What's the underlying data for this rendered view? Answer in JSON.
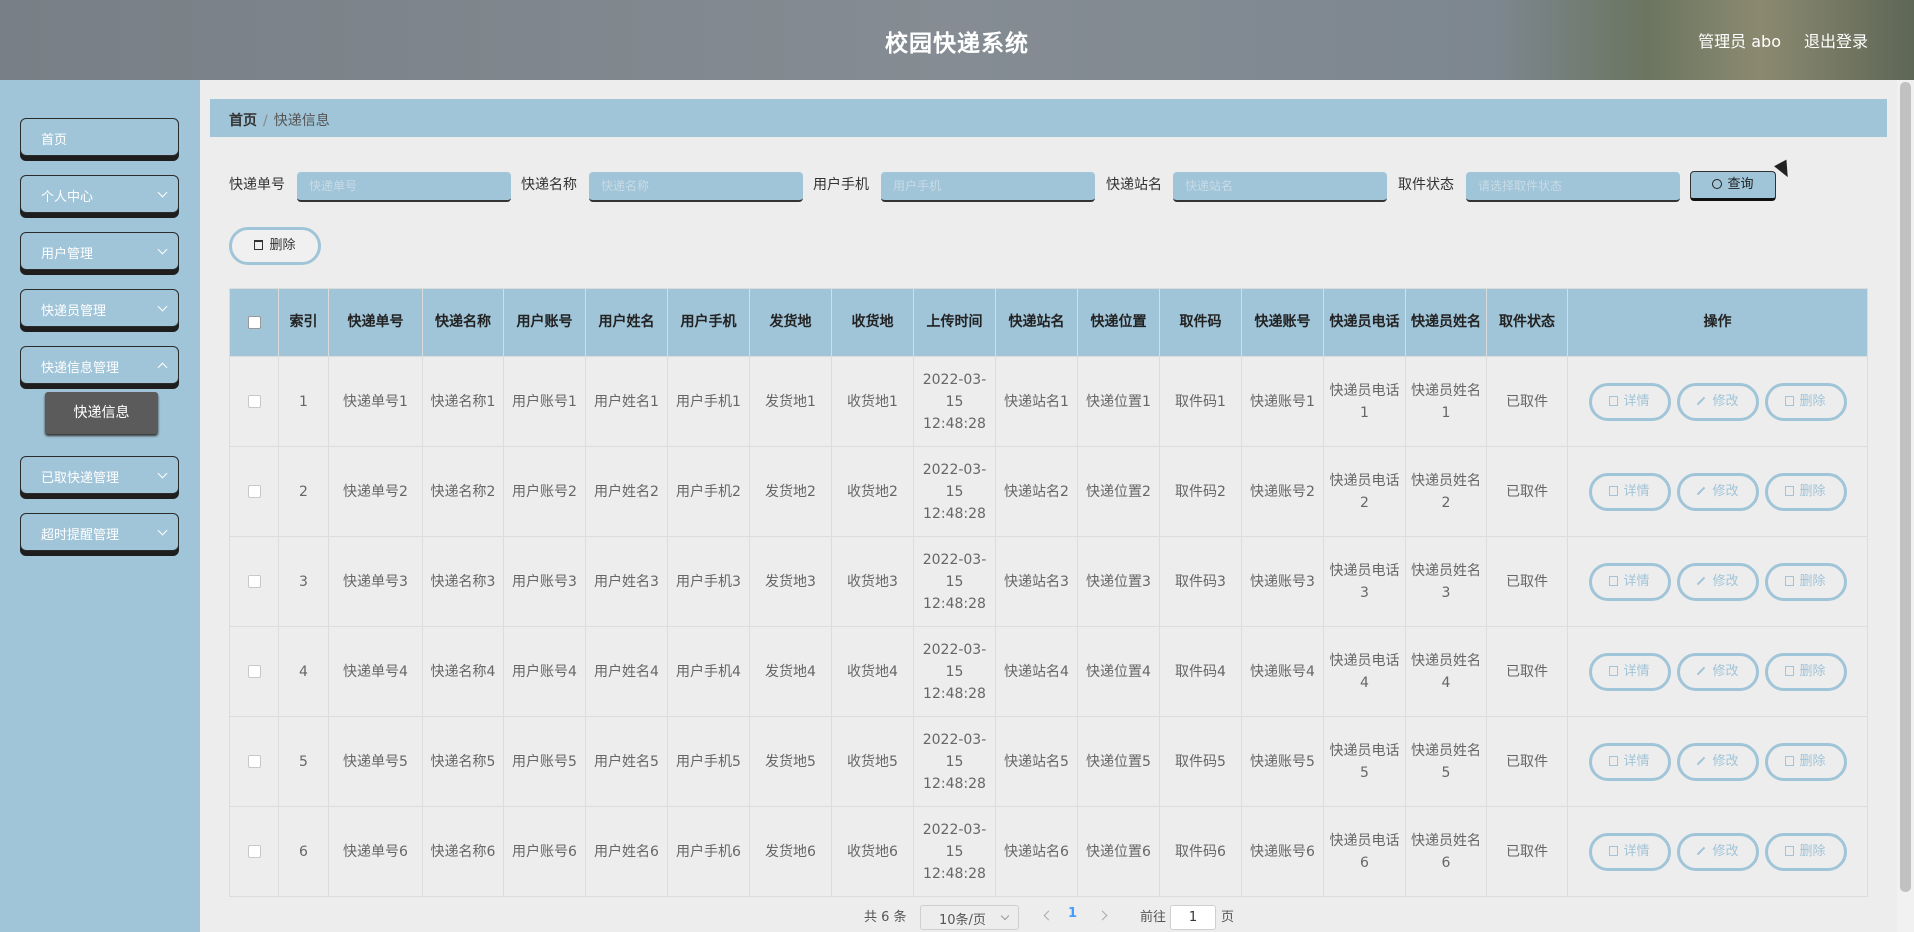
{
  "header": {
    "title": "校园快递系统",
    "user": "管理员 abo",
    "logout": "退出登录"
  },
  "sidebar": {
    "items": [
      {
        "label": "首页",
        "has_children": false
      },
      {
        "label": "个人中心",
        "has_children": true
      },
      {
        "label": "用户管理",
        "has_children": true
      },
      {
        "label": "快递员管理",
        "has_children": true
      },
      {
        "label": "快递信息管理",
        "has_children": true
      },
      {
        "label": "已取快递管理",
        "has_children": true
      },
      {
        "label": "超时提醒管理",
        "has_children": true
      }
    ],
    "active_sub": "快递信息"
  },
  "breadcrumb": {
    "home": "首页",
    "current": "快递信息"
  },
  "search": {
    "fields": [
      {
        "label": "快递单号",
        "placeholder": "快递单号"
      },
      {
        "label": "快递名称",
        "placeholder": "快递名称"
      },
      {
        "label": "用户手机",
        "placeholder": "用户手机"
      },
      {
        "label": "快递站名",
        "placeholder": "快递站名"
      },
      {
        "label": "取件状态",
        "placeholder": "请选择取件状态"
      }
    ],
    "query_button": "查询"
  },
  "toolbar": {
    "delete_button": "删除"
  },
  "table": {
    "columns": [
      "索引",
      "快递单号",
      "快递名称",
      "用户账号",
      "用户姓名",
      "用户手机",
      "发货地",
      "收货地",
      "上传时间",
      "快递站名",
      "快递位置",
      "取件码",
      "快递账号",
      "快递员电话",
      "快递员姓名",
      "取件状态",
      "操作"
    ],
    "rows": [
      {
        "index": "1",
        "cells": [
          "快递单号1",
          "快递名称1",
          "用户账号1",
          "用户姓名1",
          "用户手机1",
          "发货地1",
          "收货地1",
          "2022-03-15 12:48:28",
          "快递站名1",
          "快递位置1",
          "取件码1",
          "快递账号1",
          "快递员电话1",
          "快递员姓名1",
          "已取件"
        ]
      },
      {
        "index": "2",
        "cells": [
          "快递单号2",
          "快递名称2",
          "用户账号2",
          "用户姓名2",
          "用户手机2",
          "发货地2",
          "收货地2",
          "2022-03-15 12:48:28",
          "快递站名2",
          "快递位置2",
          "取件码2",
          "快递账号2",
          "快递员电话2",
          "快递员姓名2",
          "已取件"
        ]
      },
      {
        "index": "3",
        "cells": [
          "快递单号3",
          "快递名称3",
          "用户账号3",
          "用户姓名3",
          "用户手机3",
          "发货地3",
          "收货地3",
          "2022-03-15 12:48:28",
          "快递站名3",
          "快递位置3",
          "取件码3",
          "快递账号3",
          "快递员电话3",
          "快递员姓名3",
          "已取件"
        ]
      },
      {
        "index": "4",
        "cells": [
          "快递单号4",
          "快递名称4",
          "用户账号4",
          "用户姓名4",
          "用户手机4",
          "发货地4",
          "收货地4",
          "2022-03-15 12:48:28",
          "快递站名4",
          "快递位置4",
          "取件码4",
          "快递账号4",
          "快递员电话4",
          "快递员姓名4",
          "已取件"
        ]
      },
      {
        "index": "5",
        "cells": [
          "快递单号5",
          "快递名称5",
          "用户账号5",
          "用户姓名5",
          "用户手机5",
          "发货地5",
          "收货地5",
          "2022-03-15 12:48:28",
          "快递站名5",
          "快递位置5",
          "取件码5",
          "快递账号5",
          "快递员电话5",
          "快递员姓名5",
          "已取件"
        ]
      },
      {
        "index": "6",
        "cells": [
          "快递单号6",
          "快递名称6",
          "用户账号6",
          "用户姓名6",
          "用户手机6",
          "发货地6",
          "收货地6",
          "2022-03-15 12:48:28",
          "快递站名6",
          "快递位置6",
          "取件码6",
          "快递账号6",
          "快递员电话6",
          "快递员姓名6",
          "已取件"
        ]
      }
    ],
    "actions": {
      "detail": "详情",
      "edit": "修改",
      "delete": "删除"
    }
  },
  "pagination": {
    "total": "共 6 条",
    "page_size": "10条/页",
    "current_page": "1",
    "goto_prefix": "前往",
    "goto_value": "1",
    "goto_suffix": "页"
  },
  "colors": {
    "accent": "#a0c4d8",
    "active_sub_bg": "#5b5b5b",
    "page_active": "#409eff"
  }
}
